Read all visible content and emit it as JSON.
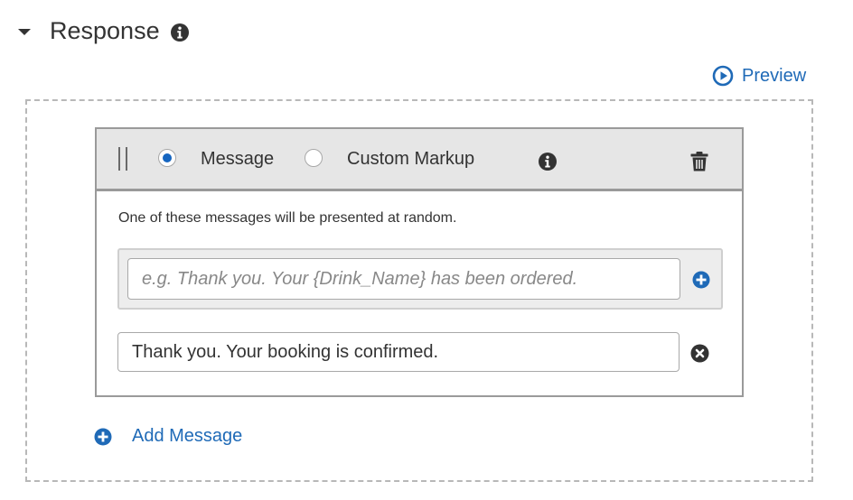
{
  "section": {
    "title": "Response",
    "caret_icon": "caret-down-icon",
    "info_icon": "info-icon"
  },
  "preview": {
    "label": "Preview",
    "icon": "play-circle-icon"
  },
  "card": {
    "radio_options": [
      {
        "label": "Message",
        "selected": true
      },
      {
        "label": "Custom Markup",
        "selected": false
      }
    ],
    "note": "One of these messages will be presented at random.",
    "new_message": {
      "value": "",
      "placeholder": "e.g. Thank you. Your {Drink_Name} has been ordered."
    },
    "messages": [
      {
        "value": "Thank you. Your booking is confirmed."
      }
    ]
  },
  "add_message": {
    "label": "Add Message",
    "icon": "plus-circle-icon"
  },
  "colors": {
    "link": "#1f6ab7",
    "radio_selected": "#1565c0",
    "header_bg": "#e6e6e6"
  }
}
